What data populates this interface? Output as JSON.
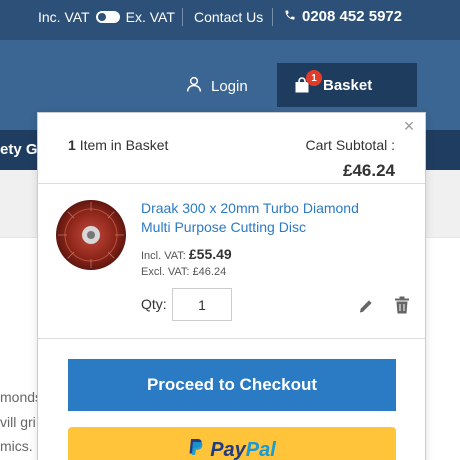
{
  "topbar": {
    "inc_vat_label": "Inc. VAT",
    "ex_vat_label": "Ex. VAT",
    "contact_label": "Contact Us",
    "phone": "0208 452 5972",
    "phone_icon": "phone-icon"
  },
  "header": {
    "login_label": "Login",
    "login_icon": "user-icon",
    "basket_label": "Basket",
    "basket_count": "1",
    "basket_icon": "shopping-bag-icon"
  },
  "nav": {
    "visible_text": "ety G"
  },
  "background_text": {
    "line1": "monds",
    "line2": "vill gri",
    "line3": "mics."
  },
  "minicart": {
    "items_count": "1",
    "items_label": "Item in Basket",
    "subtotal_label": "Cart Subtotal :",
    "subtotal_value": "£46.24",
    "close_symbol": "×",
    "item": {
      "name": "Draak 300 x 20mm Turbo Diamond Multi Purpose Cutting Disc",
      "incl_label": "Incl. VAT:",
      "incl_price": "£55.49",
      "excl_label": "Excl. VAT:",
      "excl_price": "£46.24",
      "qty_label": "Qty:",
      "qty_value": "1",
      "edit_icon": "pencil-icon",
      "remove_icon": "trash-icon"
    },
    "checkout_label": "Proceed to Checkout",
    "paypal_pay": "Pay",
    "paypal_pal": "Pal"
  },
  "colors": {
    "topbar_bg": "#2d5079",
    "header_bg": "#3b6592",
    "basket_bg": "#1e3c5e",
    "badge": "#e23b2a",
    "link_blue": "#2a7ac4",
    "paypal_yellow": "#ffc439"
  }
}
